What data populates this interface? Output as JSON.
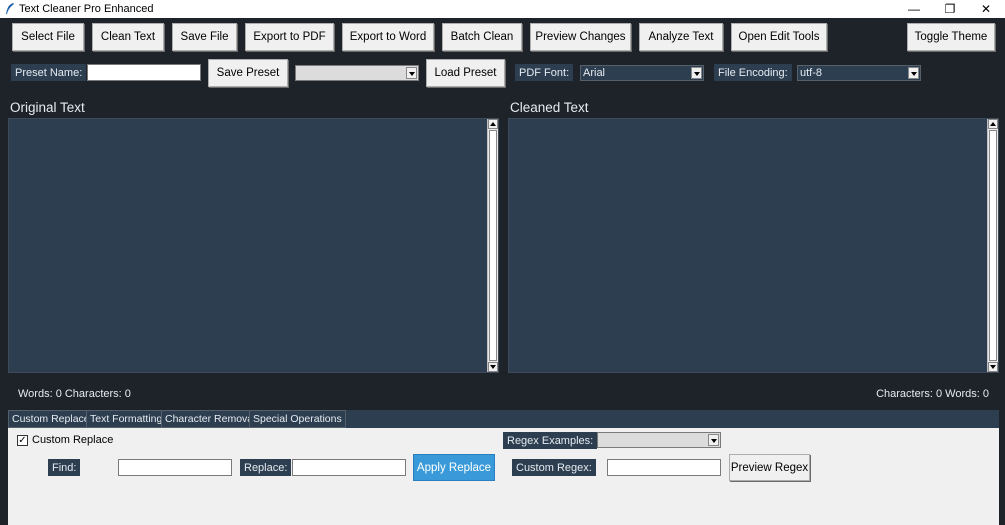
{
  "window": {
    "title": "Text Cleaner Pro Enhanced",
    "controls": {
      "minimize": "—",
      "restore": "❐",
      "close": "✕"
    }
  },
  "toolbar": {
    "select_file": "Select File",
    "clean_text": "Clean Text",
    "save_file": "Save File",
    "export_pdf": "Export to PDF",
    "export_word": "Export to Word",
    "batch_clean": "Batch Clean",
    "preview_changes": "Preview Changes",
    "analyze_text": "Analyze Text",
    "open_edit_tools": "Open Edit Tools",
    "toggle_theme": "Toggle Theme"
  },
  "preset_row": {
    "preset_name_label": "Preset Name:",
    "preset_name_value": "",
    "save_preset": "Save Preset",
    "preset_select_value": "",
    "load_preset": "Load Preset",
    "pdf_font_label": "PDF Font:",
    "pdf_font_value": "Arial",
    "file_encoding_label": "File Encoding:",
    "file_encoding_value": "utf-8"
  },
  "original": {
    "title": "Original Text",
    "content": "",
    "stats": "Words: 0  Characters: 0"
  },
  "cleaned": {
    "title": "Cleaned Text",
    "content": "",
    "stats": "Characters: 0  Words: 0"
  },
  "tabs": [
    {
      "label": "Custom Replace",
      "active": true
    },
    {
      "label": "Text Formatting",
      "active": false
    },
    {
      "label": "Character Removal",
      "active": false
    },
    {
      "label": "Special Operations",
      "active": false
    }
  ],
  "custom_replace": {
    "checkbox_label": "Custom Replace",
    "checked": true,
    "check_mark": "✓",
    "regex_examples_label": "Regex Examples:",
    "regex_examples_value": "",
    "find_label": "Find:",
    "find_value": "",
    "replace_label": "Replace:",
    "replace_value": "",
    "apply_replace": "Apply Replace",
    "custom_regex_label": "Custom Regex:",
    "custom_regex_value": "",
    "preview_regex": "Preview Regex"
  },
  "colors": {
    "background": "#1e2329",
    "panel": "#2d3e50",
    "accent": "#3a9ad9"
  }
}
